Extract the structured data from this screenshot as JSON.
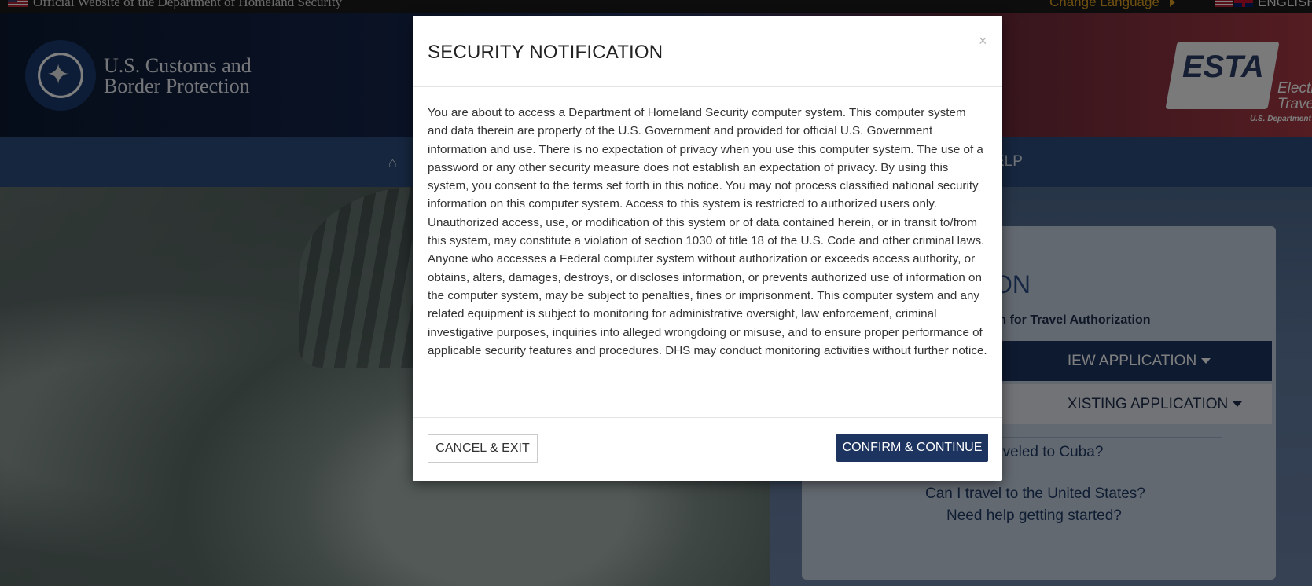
{
  "topbar": {
    "official_text": "Official Website of the Department of Homeland Security",
    "change_language": "Change Language",
    "language": "ENGLISH"
  },
  "header": {
    "agency_line1": "U.S. Customs and",
    "agency_line2": "Border Protection",
    "esta_logo_text": "ESTA",
    "esta_subtitle_line1": "Electro",
    "esta_subtitle_line2": "Travel A",
    "esta_subtitle_line3": "U.S. Department of H"
  },
  "nav": {
    "help_partial": "ELP"
  },
  "card": {
    "title_partial": "ON",
    "subtitle_partial": "em for Travel Authorization",
    "new_application": "IEW APPLICATION",
    "existing_application": "XISTING APPLICATION",
    "link_cuba": "aveled to Cuba?",
    "link_travel": "Can I travel to the United States?",
    "link_help": "Need help getting started?"
  },
  "modal": {
    "title": "SECURITY NOTIFICATION",
    "close": "×",
    "body": "You are about to access a Department of Homeland Security computer system. This computer system and data therein are property of the U.S. Government and provided for official U.S. Government information and use. There is no expectation of privacy when you use this computer system. The use of a password or any other security measure does not establish an expectation of privacy. By using this system, you consent to the terms set forth in this notice. You may not process classified national security information on this computer system. Access to this system is restricted to authorized users only. Unauthorized access, use, or modification of this system or of data contained herein, or in transit to/from this system, may constitute a violation of section 1030 of title 18 of the U.S. Code and other criminal laws. Anyone who accesses a Federal computer system without authorization or exceeds access authority, or obtains, alters, damages, destroys, or discloses information, or prevents authorized use of information on the computer system, may be subject to penalties, fines or imprisonment. This computer system and any related equipment is subject to monitoring for administrative oversight, law enforcement, criminal investigative purposes, inquiries into alleged wrongdoing or misuse, and to ensure proper performance of applicable security features and procedures. DHS may conduct monitoring activities without further notice.",
    "cancel_label": "CANCEL & EXIT",
    "confirm_label": "CONFIRM & CONTINUE"
  },
  "colors": {
    "primary_navy": "#1d3460",
    "nav_blue": "#2d4c7c",
    "accent_gold": "#e0a120"
  },
  "icons": {
    "home": "home-icon",
    "close": "close-icon",
    "caret": "caret-down-icon"
  }
}
